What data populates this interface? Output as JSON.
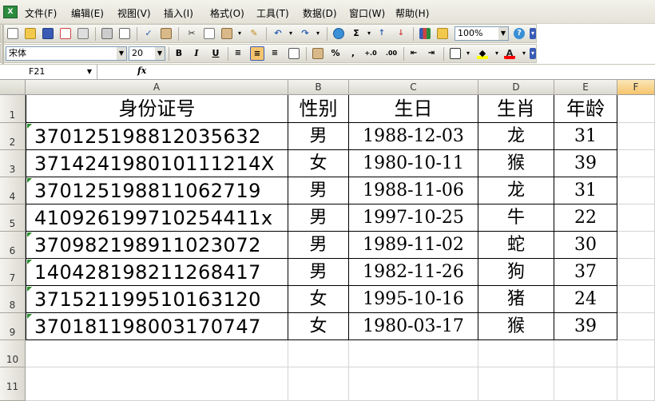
{
  "menu": {
    "app_icon": "X",
    "items": [
      "文件(F)",
      "编辑(E)",
      "视图(V)",
      "插入(I)",
      "格式(O)",
      "工具(T)",
      "数据(D)",
      "窗口(W)",
      "帮助(H)"
    ]
  },
  "toolbar": {
    "zoom": "100%",
    "sum_symbol": "Σ",
    "font_name": "宋体",
    "font_size": "20",
    "bold": "B",
    "italic": "I",
    "underline": "U",
    "percent": "%",
    "comma": ",",
    "inc_decimal": "+.0",
    "dec_decimal": ".00",
    "fill_color": "#ffff00",
    "font_color": "#ff0000"
  },
  "formula_bar": {
    "name_box": "F21",
    "fx_label": "fx",
    "content": ""
  },
  "columns": [
    "A",
    "B",
    "C",
    "D",
    "E",
    "F"
  ],
  "rows": [
    "1",
    "2",
    "3",
    "4",
    "5",
    "6",
    "7",
    "8",
    "9",
    "10",
    "11"
  ],
  "table": {
    "headers": [
      "身份证号",
      "性别",
      "生日",
      "生肖",
      "年龄"
    ],
    "data": [
      [
        "370125198812035632",
        "男",
        "1988-12-03",
        "龙",
        "31"
      ],
      [
        "371424198010111214X",
        "女",
        "1980-10-11",
        "猴",
        "39"
      ],
      [
        "370125198811062719",
        "男",
        "1988-11-06",
        "龙",
        "31"
      ],
      [
        "410926199710254411x",
        "男",
        "1997-10-25",
        "牛",
        "22"
      ],
      [
        "370982198911023072",
        "男",
        "1989-11-02",
        "蛇",
        "30"
      ],
      [
        "140428198211268417",
        "男",
        "1982-11-26",
        "狗",
        "37"
      ],
      [
        "371521199510163120",
        "女",
        "1995-10-16",
        "猪",
        "24"
      ],
      [
        "370181198003170747",
        "女",
        "1980-03-17",
        "猴",
        "39"
      ]
    ]
  }
}
